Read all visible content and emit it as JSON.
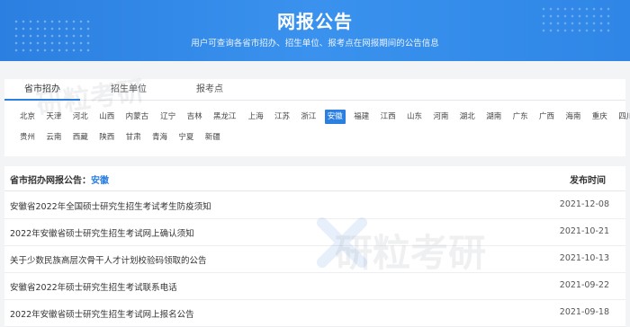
{
  "header": {
    "title": "网报公告",
    "subtitle": "用户可查询各省市招办、招生单位、报考点在网报期间的公告信息"
  },
  "tabs": [
    "省市招办",
    "招生单位",
    "报考点"
  ],
  "provinces_row1": [
    "北京",
    "天津",
    "河北",
    "山西",
    "内蒙古",
    "辽宁",
    "吉林",
    "黑龙江",
    "上海",
    "江苏",
    "浙江",
    "安徽",
    "福建",
    "江西",
    "山东",
    "河南",
    "湖北",
    "湖南",
    "广东",
    "广西",
    "海南",
    "重庆",
    "四川"
  ],
  "provinces_row2": [
    "贵州",
    "云南",
    "西藏",
    "陕西",
    "甘肃",
    "青海",
    "宁夏",
    "新疆"
  ],
  "active_province": "安徽",
  "list": {
    "label": "省市招办网报公告：",
    "province": "安徽",
    "time_header": "发布时间",
    "rows": [
      {
        "title": "安徽省2022年全国硕士研究生招生考试考生防疫须知",
        "date": "2021-12-08"
      },
      {
        "title": "2022年安徽省硕士研究生招生考试网上确认须知",
        "date": "2021-10-21"
      },
      {
        "title": "关于少数民族高层次骨干人才计划校验码领取的公告",
        "date": "2021-10-13"
      },
      {
        "title": "安徽省2022年硕士研究生招生考试联系电话",
        "date": "2021-09-22"
      },
      {
        "title": "2022年安徽省硕士研究生招生考试网上报名公告",
        "date": "2021-09-18"
      }
    ]
  },
  "watermark": "研粒考研"
}
